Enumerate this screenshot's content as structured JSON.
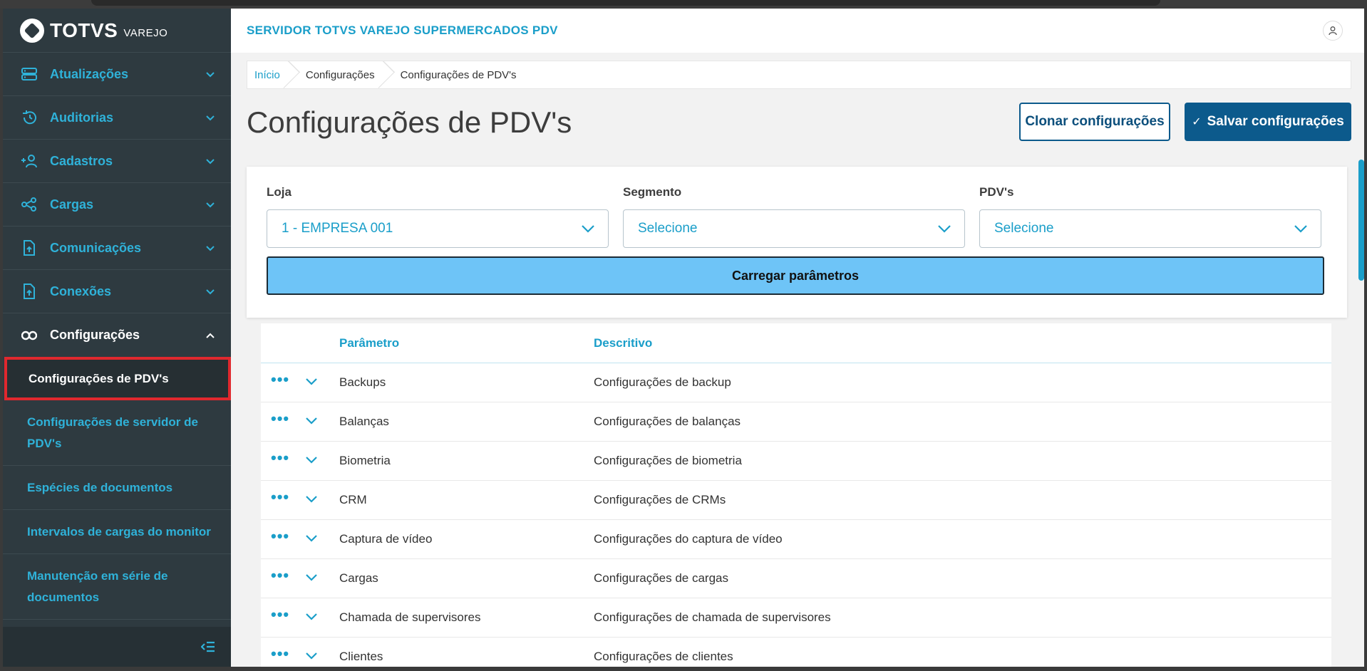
{
  "brand": {
    "name": "TOTVS",
    "sub": "VAREJO"
  },
  "header": {
    "title": "SERVIDOR TOTVS VAREJO SUPERMERCADOS PDV"
  },
  "sidebar": {
    "items": [
      {
        "label": "Atualizações",
        "icon": "server-icon"
      },
      {
        "label": "Auditorias",
        "icon": "history-icon"
      },
      {
        "label": "Cadastros",
        "icon": "add-user-icon"
      },
      {
        "label": "Cargas",
        "icon": "share-icon"
      },
      {
        "label": "Comunicações",
        "icon": "upload-file-icon"
      },
      {
        "label": "Conexões",
        "icon": "upload-file-icon"
      },
      {
        "label": "Configurações",
        "icon": "link-icon"
      }
    ],
    "subitems": [
      "Configurações de PDV's",
      "Configurações de servidor de PDV's",
      "Espécies de documentos",
      "Intervalos de cargas do monitor",
      "Manutenção em série de documentos"
    ]
  },
  "breadcrumb": [
    "Início",
    "Configurações",
    "Configurações de PDV's"
  ],
  "page": {
    "title": "Configurações de PDV's",
    "clone_label": "Clonar configurações",
    "save_label": "Salvar configurações"
  },
  "filters": {
    "loja": {
      "label": "Loja",
      "value": "1 - EMPRESA 001"
    },
    "segmento": {
      "label": "Segmento",
      "value": "Selecione"
    },
    "pdvs": {
      "label": "PDV's",
      "value": "Selecione"
    },
    "load_label": "Carregar parâmetros"
  },
  "table": {
    "columns": [
      "Parâmetro",
      "Descritivo"
    ],
    "rows": [
      {
        "param": "Backups",
        "desc": "Configurações de backup"
      },
      {
        "param": "Balanças",
        "desc": "Configurações de balanças"
      },
      {
        "param": "Biometria",
        "desc": "Configurações de biometria"
      },
      {
        "param": "CRM",
        "desc": "Configurações de CRMs"
      },
      {
        "param": "Captura de vídeo",
        "desc": "Configurações do captura de vídeo"
      },
      {
        "param": "Cargas",
        "desc": "Configurações de cargas"
      },
      {
        "param": "Chamada de supervisores",
        "desc": "Configurações de chamada de supervisores"
      },
      {
        "param": "Clientes",
        "desc": "Configurações de clientes"
      }
    ]
  },
  "colors": {
    "accent": "#1a9ec9",
    "primary": "#0c5a8c",
    "sidebar": "#2e3a40",
    "load": "#6ec4f7",
    "highlight": "#e0282e"
  }
}
